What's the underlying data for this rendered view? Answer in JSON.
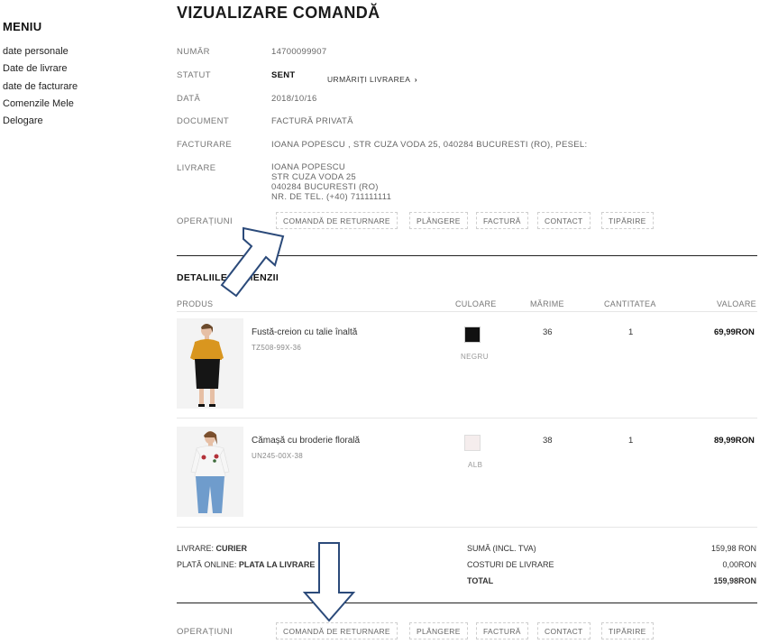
{
  "sidebar": {
    "title": "MENIU",
    "items": [
      {
        "label": "date personale"
      },
      {
        "label": "Date de livrare"
      },
      {
        "label": "date de facturare"
      },
      {
        "label": "Comenzile Mele"
      },
      {
        "label": "Delogare"
      }
    ]
  },
  "page": {
    "title": "VIZUALIZARE COMANDĂ"
  },
  "order": {
    "number_label": "NUMĂR",
    "number": "14700099907",
    "status_label": "STATUT",
    "status": "SENT",
    "track_link": "URMĂRIȚI LIVRAREA",
    "date_label": "DATĂ",
    "date": "2018/10/16",
    "document_label": "DOCUMENT",
    "document": "FACTURĂ PRIVATĂ",
    "billing_label": "FACTURARE",
    "billing": "IOANA POPESCU , STR CUZA VODA 25, 040284 BUCURESTI (RO), PESEL:",
    "shipping_label": "LIVRARE",
    "shipping_lines": [
      "IOANA POPESCU",
      "STR CUZA VODA 25",
      "040284 BUCURESTI (RO)",
      "NR. DE TEL. (+40) 711111111"
    ]
  },
  "operations": {
    "label": "OPERAȚIUNI",
    "buttons": [
      "COMANDĂ DE RETURNARE",
      "PLÂNGERE",
      "FACTURĂ",
      "CONTACT",
      "TIPĂRIRE"
    ]
  },
  "details": {
    "title": "DETALIILE COMENZII",
    "columns": {
      "product": "PRODUS",
      "color": "CULOARE",
      "size": "MĂRIME",
      "qty": "CANTITATEA",
      "value": "VALOARE"
    },
    "items": [
      {
        "name": "Fustă-creion cu talie înaltă",
        "sku": "TZ508-99X-36",
        "swatch": "#111111",
        "color_name": "NEGRU",
        "size": "36",
        "qty": "1",
        "value": "69,99RON"
      },
      {
        "name": "Cămașă cu broderie florală",
        "sku": "UN245-00X-38",
        "swatch": "#f5eded",
        "color_name": "ALB",
        "size": "38",
        "qty": "1",
        "value": "89,99RON"
      }
    ]
  },
  "summary": {
    "delivery_label": "LIVRARE:",
    "delivery_value": "CURIER",
    "payment_label": "PLATĂ ONLINE:",
    "payment_value": "PLATA LA LIVRARE",
    "sum_label": "SUMĂ (INCL. TVA)",
    "sum_value": "159,98 RON",
    "shipping_cost_label": "COSTURI DE LIVRARE",
    "shipping_cost_value": "0,00RON",
    "total_label": "TOTAL",
    "total_value": "159,98RON"
  },
  "colors": {
    "arrow_stroke": "#2b4a7a",
    "divider": "#222222",
    "skirt_top": "#d9961f"
  }
}
